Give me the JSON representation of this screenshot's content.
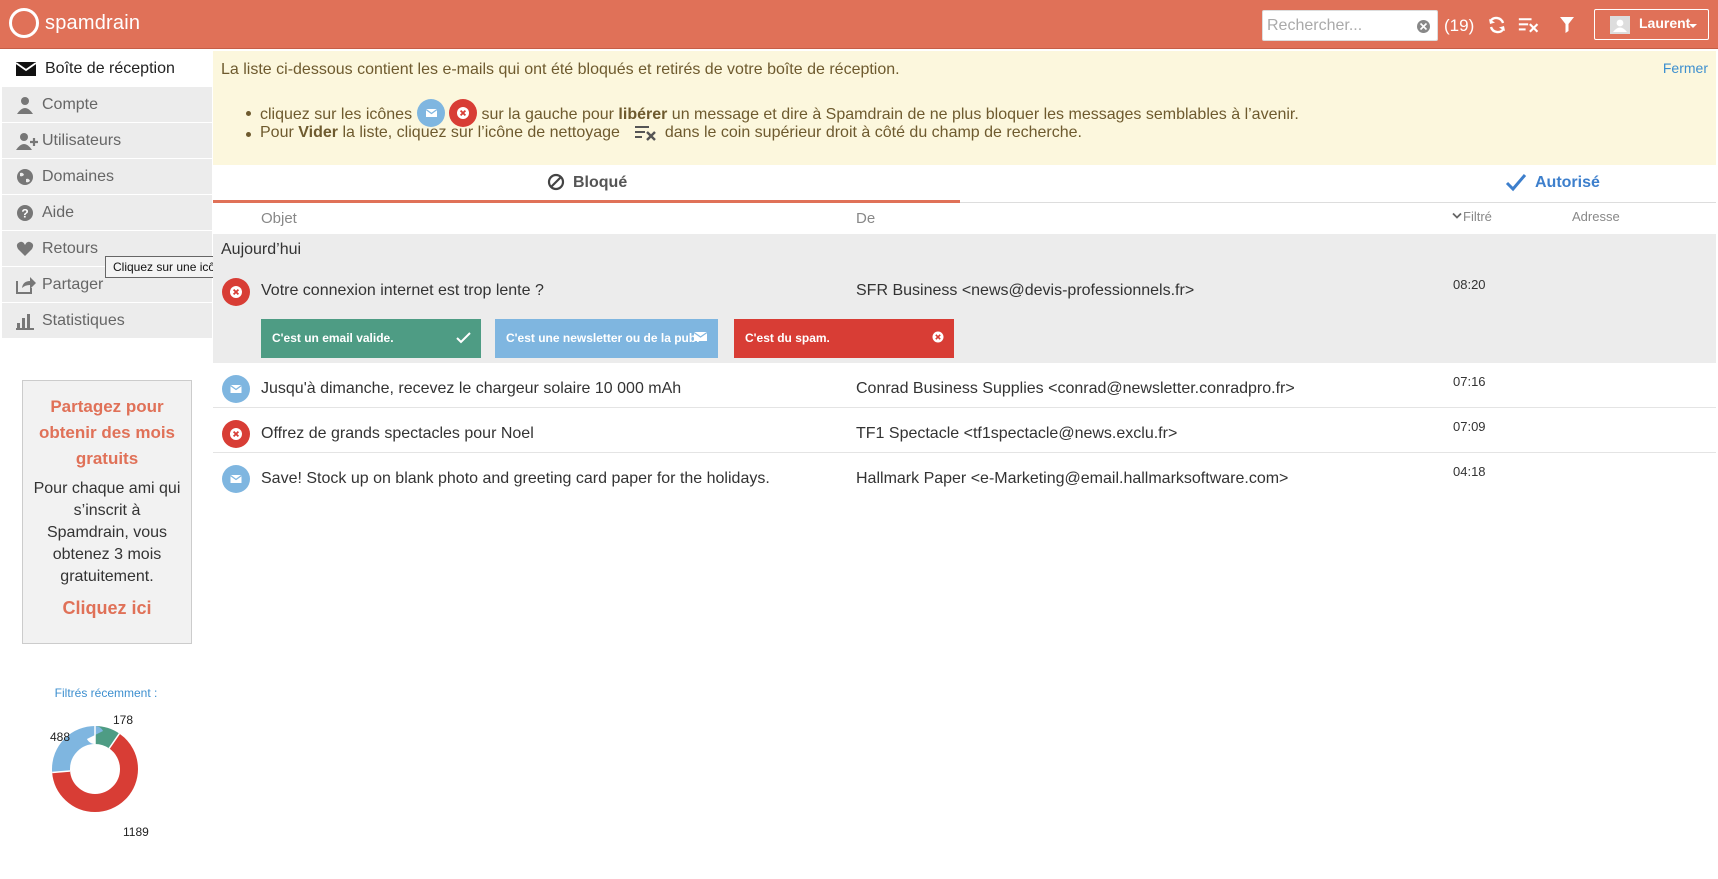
{
  "header": {
    "brand": "spamdrain",
    "search_placeholder": "Rechercher...",
    "count": "(19)",
    "user_name": "Laurent",
    "icons": [
      "refresh-icon",
      "clear-list-icon",
      "filter-icon",
      "user-avatar-icon",
      "caret-down-icon"
    ],
    "color": "#e07158"
  },
  "sidebar": {
    "items": [
      {
        "label": "Boîte de réception",
        "icon": "envelope-icon"
      },
      {
        "label": "Compte",
        "icon": "user-icon"
      },
      {
        "label": "Utilisateurs",
        "icon": "user-plus-icon"
      },
      {
        "label": "Domaines",
        "icon": "globe-icon"
      },
      {
        "label": "Aide",
        "icon": "question-icon"
      },
      {
        "label": "Retours",
        "icon": "heart-icon"
      },
      {
        "label": "Partager",
        "icon": "share-icon"
      },
      {
        "label": "Statistiques",
        "icon": "bar-chart-icon"
      }
    ],
    "tooltip": "Cliquez sur une icône pour changer de statut.",
    "promo": {
      "title": "Partagez pour obtenir des mois gratuits",
      "text": "Pour chaque ami qui s’inscrit à Spamdrain, vous obtenez 3 mois gratuitement.",
      "link": "Cliquez ici"
    },
    "recent": {
      "label": "Filtrés récemment :",
      "segments": [
        {
          "value": 178,
          "color": "#4e9c84"
        },
        {
          "value": 1189,
          "color": "#d83d35"
        },
        {
          "value": 488,
          "color": "#7fb6e0"
        }
      ],
      "labels": {
        "valid": "178",
        "spam": "1189",
        "newsletter": "488"
      }
    }
  },
  "info": {
    "lead": "La liste ci-dessous contient les e-mails qui ont été bloqués et retirés de votre boîte de réception.",
    "close": "Fermer",
    "line1_a": "cliquez sur les icônes",
    "line1_b": "sur la gauche pour",
    "line1_bold": "libérer",
    "line1_c": "un message et dire à Spamdrain de ne plus bloquer les messages semblables à l’avenir.",
    "line2_a": "Pour",
    "line2_bold": "Vider",
    "line2_b": "la liste, cliquez sur l’icône de nettoyage",
    "line2_c": "dans le coin supérieur droit à côté du champ de recherche."
  },
  "tabs": {
    "blocked": "Bloqué",
    "allowed": "Autorisé"
  },
  "columns": {
    "subject": "Objet",
    "from": "De",
    "filtered": "Filtré",
    "address": "Adresse"
  },
  "day_label": "Aujourd’hui",
  "actions": {
    "valid": "C'est un email valide.",
    "newsletter": "C'est une newsletter ou de la pub.",
    "spam": "C'est du spam."
  },
  "messages": [
    {
      "subject": "Votre connexion internet est trop lente ?",
      "from": "SFR Business <news@devis-professionnels.fr>",
      "time": "08:20",
      "status": "spam"
    },
    {
      "subject": "Jusqu'à dimanche, recevez le chargeur solaire 10 000 mAh",
      "from": "Conrad Business Supplies <conrad@newsletter.conradpro.fr>",
      "time": "07:16",
      "status": "newsletter"
    },
    {
      "subject": "Offrez de grands spectacles pour Noel",
      "from": "TF1 Spectacle <tf1spectacle@news.exclu.fr>",
      "time": "07:09",
      "status": "spam"
    },
    {
      "subject": "Save! Stock up on blank photo and greeting card paper for the holidays.",
      "from": "Hallmark Paper <e-Marketing@email.hallmarksoftware.com>",
      "time": "04:18",
      "status": "newsletter"
    }
  ]
}
